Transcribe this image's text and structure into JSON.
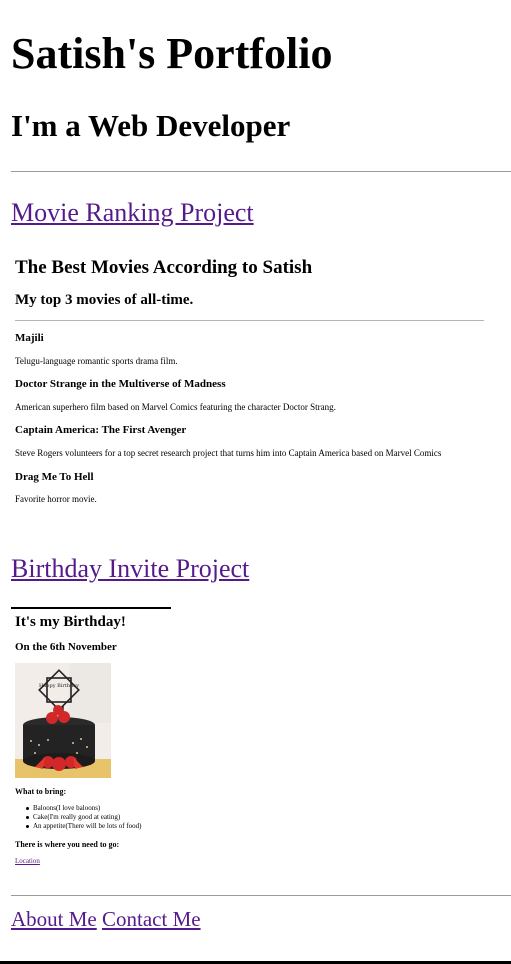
{
  "header": {
    "title": "Satish's Portfolio",
    "subtitle": "I'm a Web Developer"
  },
  "movie_project": {
    "link_label": "Movie Ranking Project",
    "heading": "The Best Movies According to Satish",
    "subheading": "My top 3 movies of all-time.",
    "movies": [
      {
        "name": "Majili",
        "description": "Telugu-language romantic sports drama film."
      },
      {
        "name": "Doctor Strange in the Multiverse of Madness",
        "description": "American superhero film based on Marvel Comics featuring the character Doctor Strang."
      },
      {
        "name": "Captain America: The First Avenger",
        "description": "Steve Rogers volunteers for a top secret research project that turns him into Captain America based on Marvel Comics"
      },
      {
        "name": "Drag Me To Hell",
        "description": "Favorite horror movie."
      }
    ]
  },
  "birthday_project": {
    "link_label": "Birthday Invite Project",
    "heading": "It's my Birthday!",
    "date": "On the 6th November",
    "cake_topper_text": "Happy Birthday",
    "bring_heading": "What to bring:",
    "bring_items": [
      "Baloons(I love baloons)",
      "Cake(I'm really good at eating)",
      "An appetite(There will be lots of food)"
    ],
    "location_heading": "There is where you need to go:",
    "location_link": "Location"
  },
  "footer": {
    "about_label": "About Me",
    "contact_label": "Contact Me"
  },
  "colors": {
    "link": "#551a8b",
    "rule": "#9a9a9a",
    "text": "#000000"
  }
}
